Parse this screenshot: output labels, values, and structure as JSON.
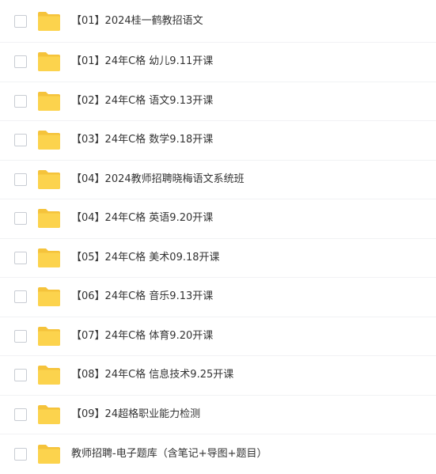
{
  "files": {
    "items": [
      {
        "name": "【01】2024桂一鹤教招语文",
        "type": "folder"
      },
      {
        "name": "【01】24年C格 幼儿9.11开课",
        "type": "folder"
      },
      {
        "name": "【02】24年C格 语文9.13开课",
        "type": "folder"
      },
      {
        "name": "【03】24年C格 数学9.18开课",
        "type": "folder"
      },
      {
        "name": "【04】2024教师招聘晓梅语文系统班",
        "type": "folder"
      },
      {
        "name": "【04】24年C格 英语9.20开课",
        "type": "folder"
      },
      {
        "name": "【05】24年C格 美术09.18开课",
        "type": "folder"
      },
      {
        "name": "【06】24年C格 音乐9.13开课",
        "type": "folder"
      },
      {
        "name": "【07】24年C格 体育9.20开课",
        "type": "folder"
      },
      {
        "name": "【08】24年C格 信息技术9.25开课",
        "type": "folder"
      },
      {
        "name": "【09】24超格职业能力检测",
        "type": "folder"
      },
      {
        "name": "教师招聘-电子题库（含笔记+导图+题目）",
        "type": "folder"
      }
    ]
  },
  "colors": {
    "folder_back": "#f5c33b",
    "folder_front": "#fcd34d",
    "text": "#333333",
    "divider": "#f1f2f4",
    "checkbox_border": "#c8ccd3"
  },
  "icons": {
    "folder": "folder-icon",
    "checkbox": "checkbox-icon"
  }
}
